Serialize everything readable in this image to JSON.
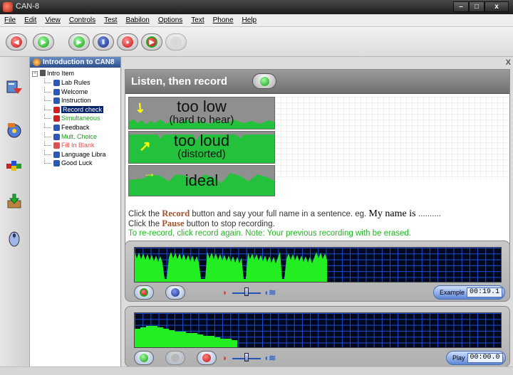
{
  "window": {
    "title": "CAN-8",
    "minimize": "–",
    "maximize": "□",
    "close": "x"
  },
  "menu": [
    "File",
    "Edit",
    "View",
    "Controls",
    "Test",
    "Babilon",
    "Options",
    "Text",
    "Phone",
    "Help"
  ],
  "toolbar": {
    "buttons": [
      "back",
      "forward",
      "play",
      "pause",
      "record",
      "record-compare",
      "speech-bubble"
    ]
  },
  "side_icons": [
    "lesson-icon",
    "media-icon",
    "blocks-icon",
    "download-icon",
    "mouse-icon"
  ],
  "tree": {
    "header": "Introduction to CAN8",
    "expander": "−",
    "root": "Intro Item",
    "items": [
      {
        "label": "Lab Rules",
        "color": "#000000",
        "icon": "person-icon"
      },
      {
        "label": "Welcome",
        "color": "#000000",
        "icon": "person-icon"
      },
      {
        "label": "Instruction",
        "color": "#000000",
        "icon": "person-icon"
      },
      {
        "label": "Record check",
        "color": "#ffffff",
        "icon": "record-icon"
      },
      {
        "label": "Simultaneous",
        "color": "#1aa01a",
        "icon": "arrows-icon"
      },
      {
        "label": "Feedback",
        "color": "#000000",
        "icon": "person-icon"
      },
      {
        "label": "Mult. Choice",
        "color": "#1aa01a",
        "icon": "cross-icon"
      },
      {
        "label": "Fill In Blank",
        "color": "#e05050",
        "icon": "question-icon"
      },
      {
        "label": "Language Libra",
        "color": "#000000",
        "icon": "person-icon"
      },
      {
        "label": "Good Luck",
        "color": "#000000",
        "icon": "person-icon"
      }
    ],
    "selected_index": 3
  },
  "main": {
    "close": "X",
    "banner_title": "Listen, then record",
    "illustrations": [
      {
        "line1": "too low",
        "line2": "(hard to hear)"
      },
      {
        "line1": "too loud",
        "line2": "(distorted)"
      },
      {
        "line1": "ideal",
        "line2": ""
      }
    ],
    "instructions": {
      "line1_a": "Click the ",
      "line1_kw": "Record",
      "line1_b": " button and say your full name in a sentence. eg. ",
      "line1_serif": "My name is ",
      "line1_dots": "..........",
      "line2_a": "Click the ",
      "line2_kw": "Pause",
      "line2_b": " button to stop recording.",
      "line3": "To re-record, click record again. Note: Your previous recording with be erased."
    }
  },
  "recorders": [
    {
      "timer_label": "Example",
      "timer_value": "00:19.1"
    },
    {
      "timer_label": "Play",
      "timer_value": "00:00.0"
    }
  ]
}
